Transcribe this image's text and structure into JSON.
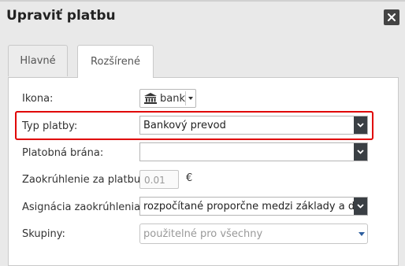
{
  "dialog": {
    "title": "Upraviť platbu",
    "close_icon": "close-icon"
  },
  "tabs": [
    {
      "label": "Hlavné",
      "active": false
    },
    {
      "label": "Rozšírené",
      "active": true
    }
  ],
  "form": {
    "icon": {
      "label": "Ikona:",
      "value": "bank",
      "icon": "bank-icon"
    },
    "payment_type": {
      "label": "Typ platby:",
      "value": "Bankový prevod"
    },
    "gateway": {
      "label": "Platobná brána:",
      "value": ""
    },
    "rounding": {
      "label": "Zaokrúhlenie za platbu:",
      "placeholder": "0.01",
      "currency": "€"
    },
    "rounding_assignment": {
      "label": "Asignácia zaokrúhlenia:",
      "value": "rozpočítané proporčne medzi základy a daň"
    },
    "groups": {
      "label": "Skupiny:",
      "placeholder": "použitelné pro všechny"
    }
  },
  "colors": {
    "highlight": "#e00000",
    "select_button": "#3a3f44",
    "dropdown_caret": "#2d5e9e"
  }
}
